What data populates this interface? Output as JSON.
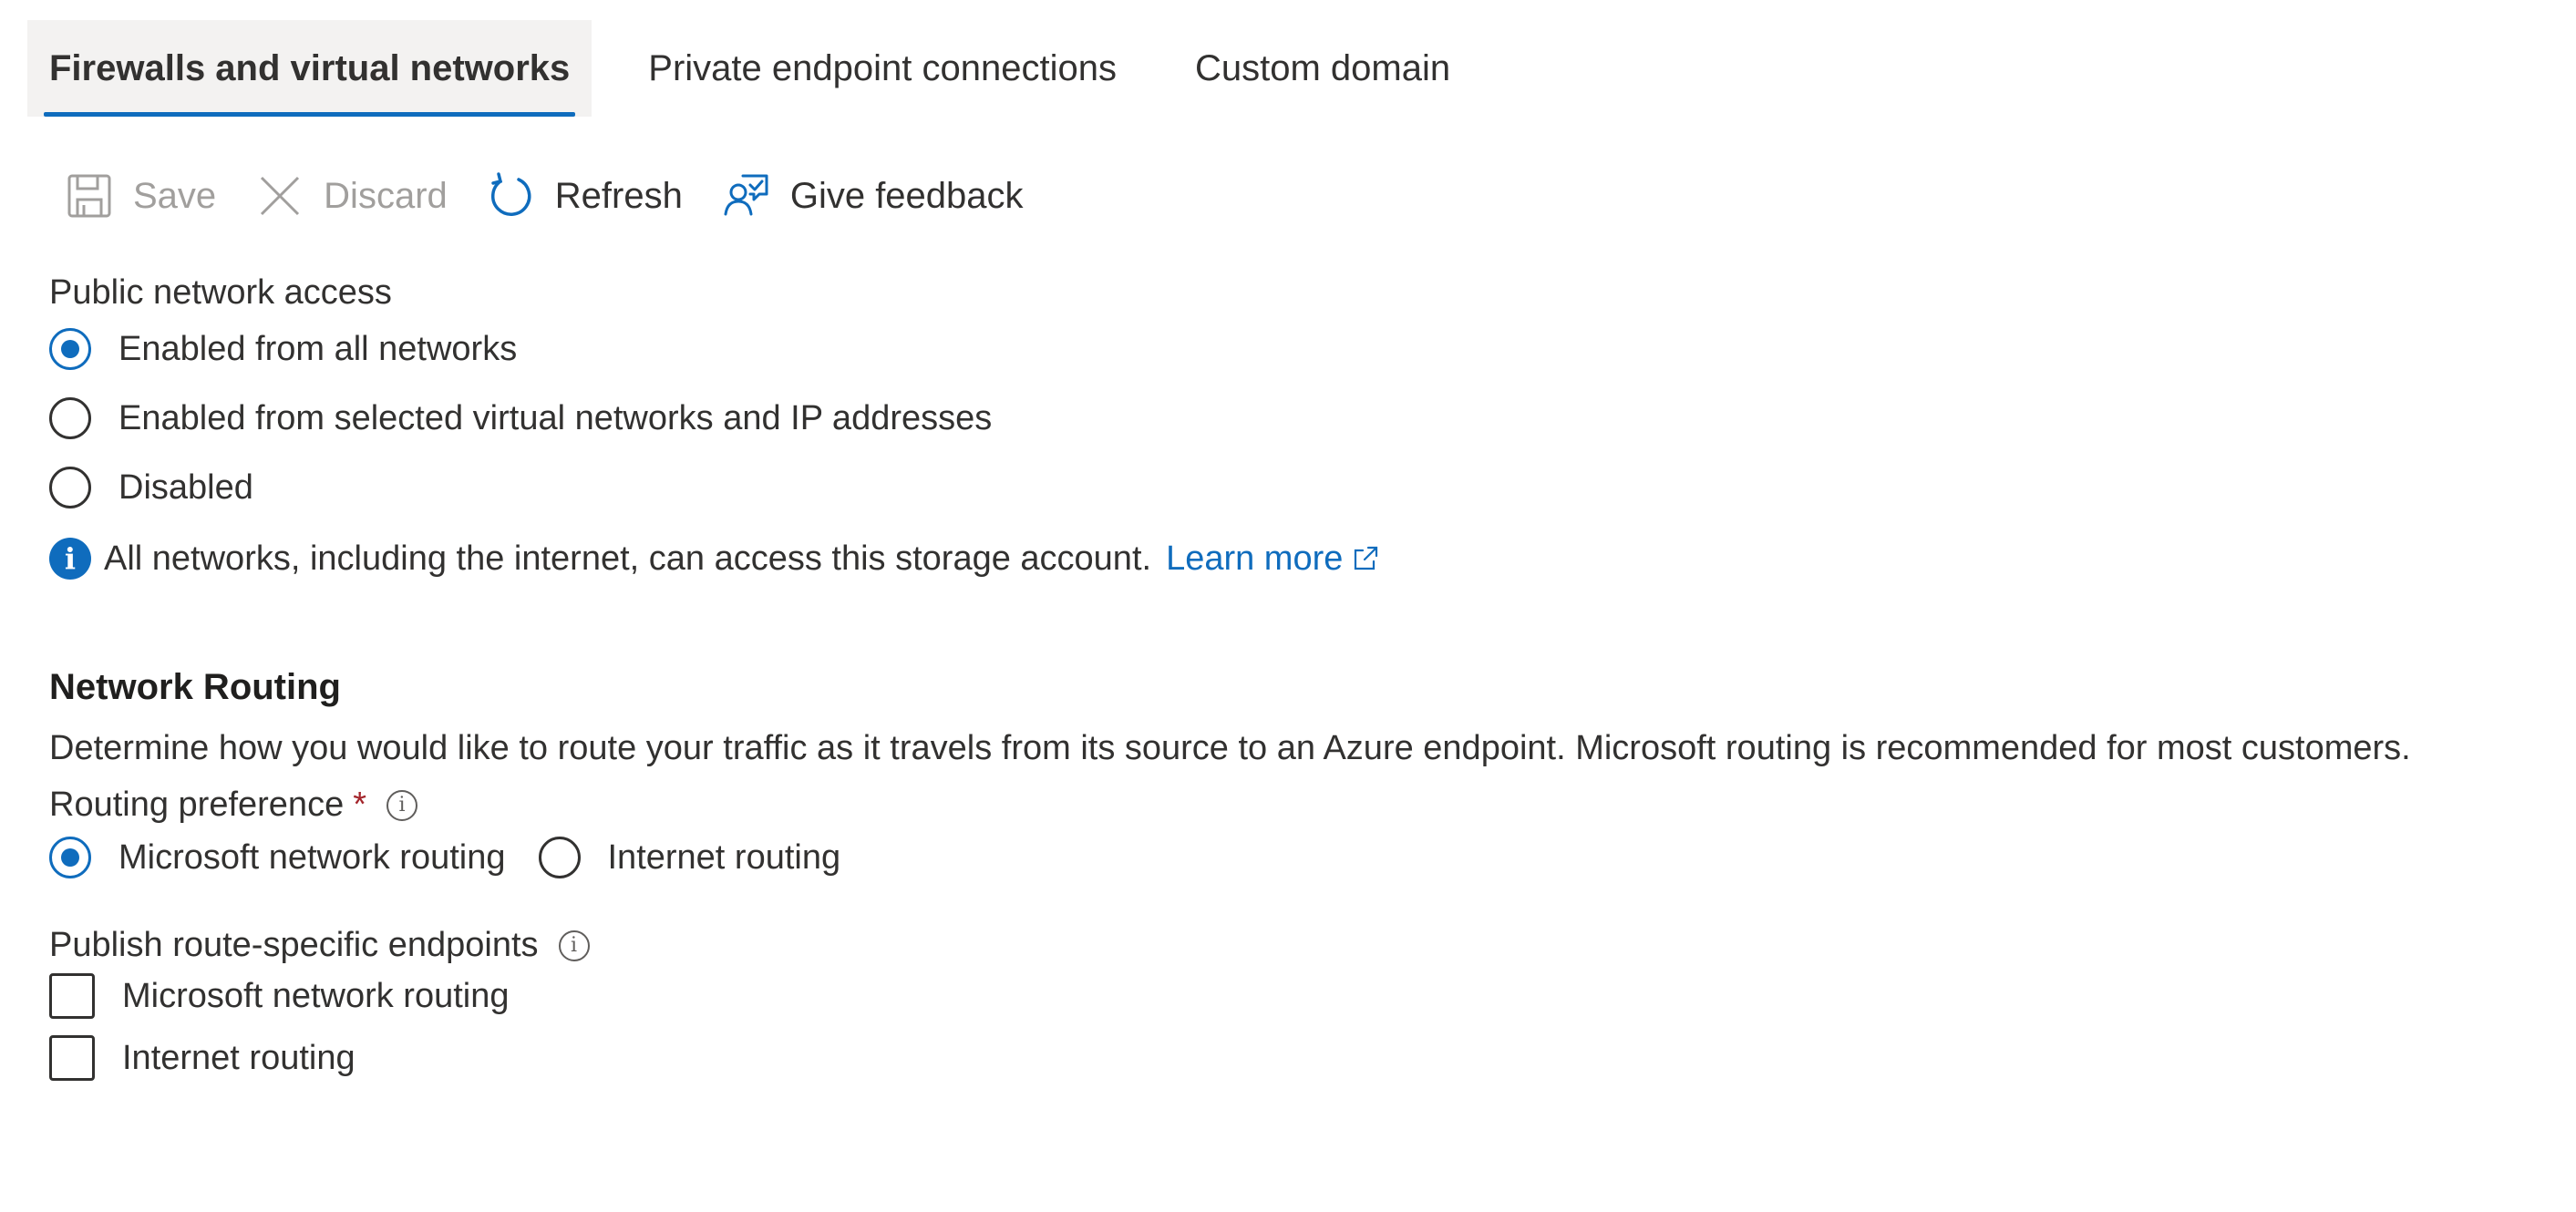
{
  "tabs": [
    {
      "label": "Firewalls and virtual networks",
      "active": true
    },
    {
      "label": "Private endpoint connections",
      "active": false
    },
    {
      "label": "Custom domain",
      "active": false
    }
  ],
  "toolbar": {
    "save": {
      "label": "Save",
      "icon": "save-icon",
      "enabled": false
    },
    "discard": {
      "label": "Discard",
      "icon": "close-icon",
      "enabled": false
    },
    "refresh": {
      "label": "Refresh",
      "icon": "refresh-icon",
      "enabled": true
    },
    "feedback": {
      "label": "Give feedback",
      "icon": "feedback-icon",
      "enabled": true
    }
  },
  "public_access": {
    "label": "Public network access",
    "options": [
      {
        "label": "Enabled from all networks",
        "selected": true
      },
      {
        "label": "Enabled from selected virtual networks and IP addresses",
        "selected": false
      },
      {
        "label": "Disabled",
        "selected": false
      }
    ],
    "info_text": "All networks, including the internet, can access this storage account.",
    "learn_more": "Learn more"
  },
  "routing": {
    "heading": "Network Routing",
    "description": "Determine how you would like to route your traffic as it travels from its source to an Azure endpoint. Microsoft routing is recommended for most customers.",
    "preference_label": "Routing preference",
    "required_marker": "*",
    "preference_options": [
      {
        "label": "Microsoft network routing",
        "selected": true
      },
      {
        "label": "Internet routing",
        "selected": false
      }
    ],
    "publish_label": "Publish route-specific endpoints",
    "publish_options": [
      {
        "label": "Microsoft network routing",
        "checked": false
      },
      {
        "label": "Internet routing",
        "checked": false
      }
    ]
  },
  "colors": {
    "accent": "#0f6cbd",
    "text": "#323130",
    "disabled": "#a19f9d",
    "required": "#a4262c",
    "tab_active_bg": "#f3f2f1"
  }
}
